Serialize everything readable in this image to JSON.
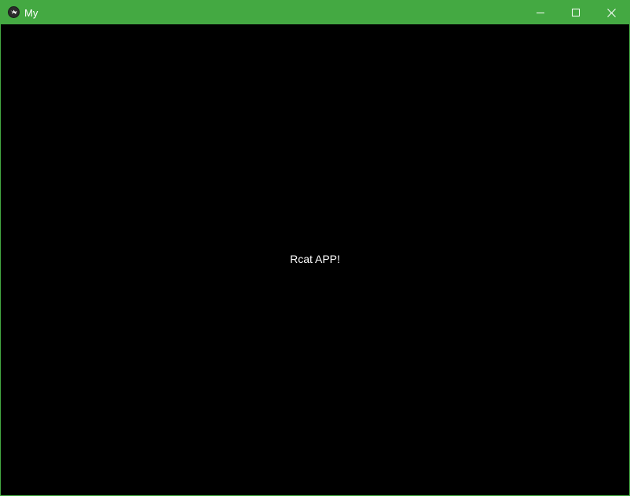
{
  "window": {
    "title": "My",
    "app_icon": "kivy-logo-icon",
    "titlebar_color": "#44a942",
    "background_color": "#000000",
    "controls": {
      "minimize_icon": "minimize-icon",
      "maximize_icon": "maximize-icon",
      "close_icon": "close-icon"
    }
  },
  "content": {
    "label": "Rcat APP!",
    "text_color": "#ffffff"
  }
}
